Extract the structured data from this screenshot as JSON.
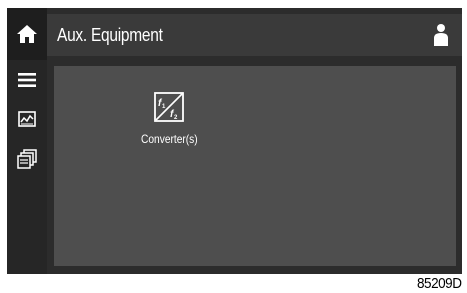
{
  "header": {
    "title": "Aux. Equipment",
    "home_icon": "home-icon",
    "user_icon": "user-icon"
  },
  "sidebar": {
    "items": [
      {
        "icon": "menu-icon"
      },
      {
        "icon": "chart-icon"
      },
      {
        "icon": "pages-icon"
      }
    ]
  },
  "main": {
    "tiles": [
      {
        "label": "Converter(s)",
        "icon": "frequency-converter-icon"
      }
    ]
  },
  "figure_code": "85209D",
  "colors": {
    "screen_bg": "#2c2c2c",
    "title_bar": "#3a3a3a",
    "content_bg": "#4e4e4e",
    "icon": "#ffffff"
  }
}
